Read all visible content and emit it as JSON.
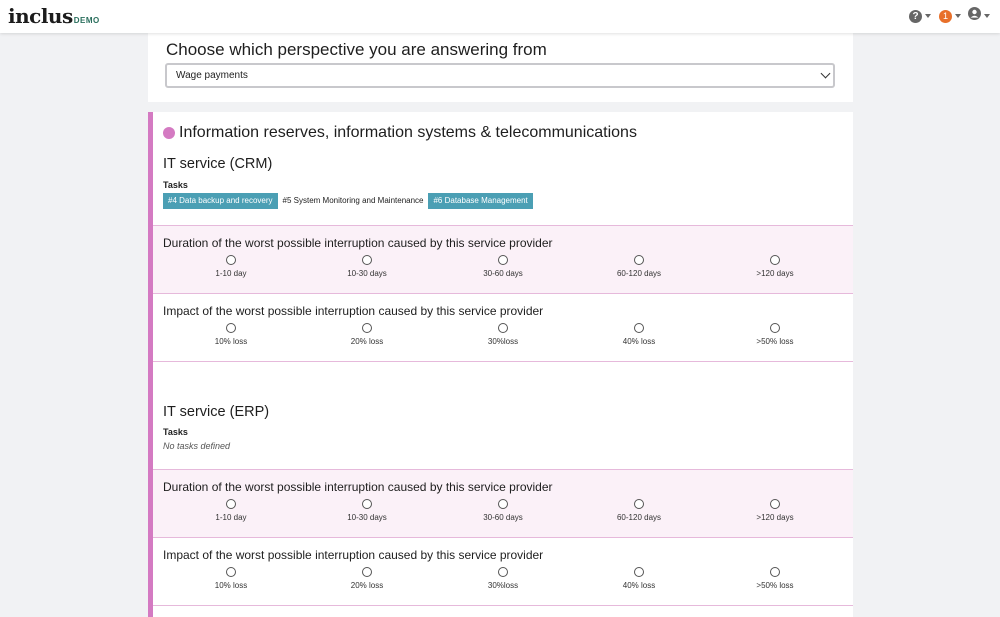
{
  "nav": {
    "logo": "inclus",
    "logo_suffix": "DEMO",
    "help_glyph": "?",
    "notification_count": "1",
    "icons": [
      "help-icon",
      "notification-icon",
      "user-icon"
    ]
  },
  "perspective": {
    "title": "Choose which perspective you are answering from",
    "selected": "Wage payments"
  },
  "category": {
    "title": "Information reserves, information systems & telecommunications",
    "color": "#d47ac2"
  },
  "services": [
    {
      "title": "IT service (CRM)",
      "tasks_label": "Tasks",
      "tasks": [
        {
          "label": "#4 Data backup and recovery",
          "selected": true
        },
        {
          "label": "#5 System Monitoring and Maintenance",
          "selected": false
        },
        {
          "label": "#6 Database Management",
          "selected": true
        }
      ],
      "questions": [
        {
          "title": "Duration of the worst possible interruption caused by this service provider",
          "options": [
            "1-10 day",
            "10-30 days",
            "30-60 days",
            "60-120 days",
            ">120 days"
          ]
        },
        {
          "title": "Impact of the worst possible interruption caused by this service provider",
          "options": [
            "10% loss",
            "20% loss",
            "30%loss",
            "40% loss",
            ">50% loss"
          ]
        }
      ]
    },
    {
      "title": "IT service (ERP)",
      "tasks_label": "Tasks",
      "no_tasks": "No tasks defined",
      "questions": [
        {
          "title": "Duration of the worst possible interruption caused by this service provider",
          "options": [
            "1-10 day",
            "10-30 days",
            "30-60 days",
            "60-120 days",
            ">120 days"
          ]
        },
        {
          "title": "Impact of the worst possible interruption caused by this service provider",
          "options": [
            "10% loss",
            "20% loss",
            "30%loss",
            "40% loss",
            ">50% loss"
          ]
        }
      ]
    }
  ],
  "colors": {
    "accent_pink": "#d47ac2",
    "task_tag": "#4b9fb4",
    "notification": "#e8702a"
  }
}
